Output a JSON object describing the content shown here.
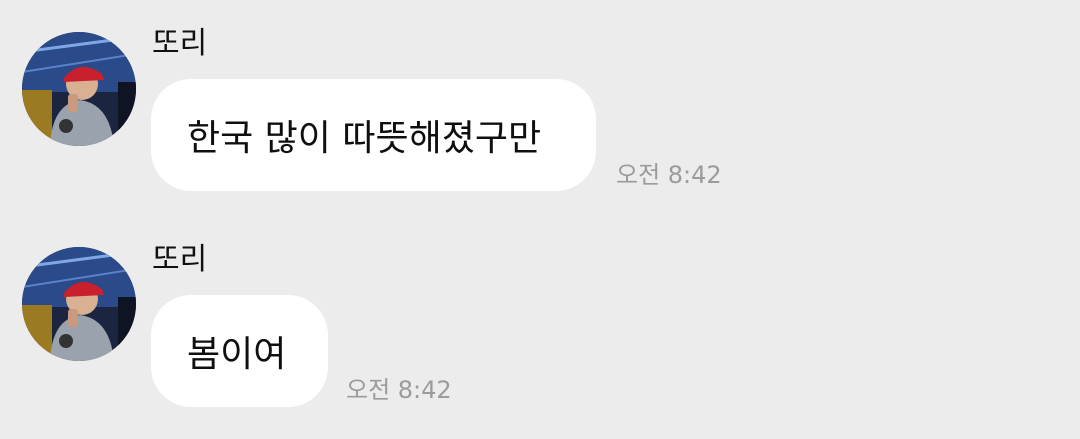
{
  "conversation": {
    "messages": [
      {
        "sender": "또리",
        "text": "한국 많이 따뜻해졌구만",
        "time": "오전 8:42",
        "avatar_icon": "profile-photo"
      },
      {
        "sender": "또리",
        "text": "봄이여",
        "time": "오전 8:42",
        "avatar_icon": "profile-photo"
      }
    ]
  },
  "colors": {
    "background": "#ececec",
    "bubble": "#ffffff",
    "timestamp": "#9b9b9b",
    "text": "#111111"
  }
}
